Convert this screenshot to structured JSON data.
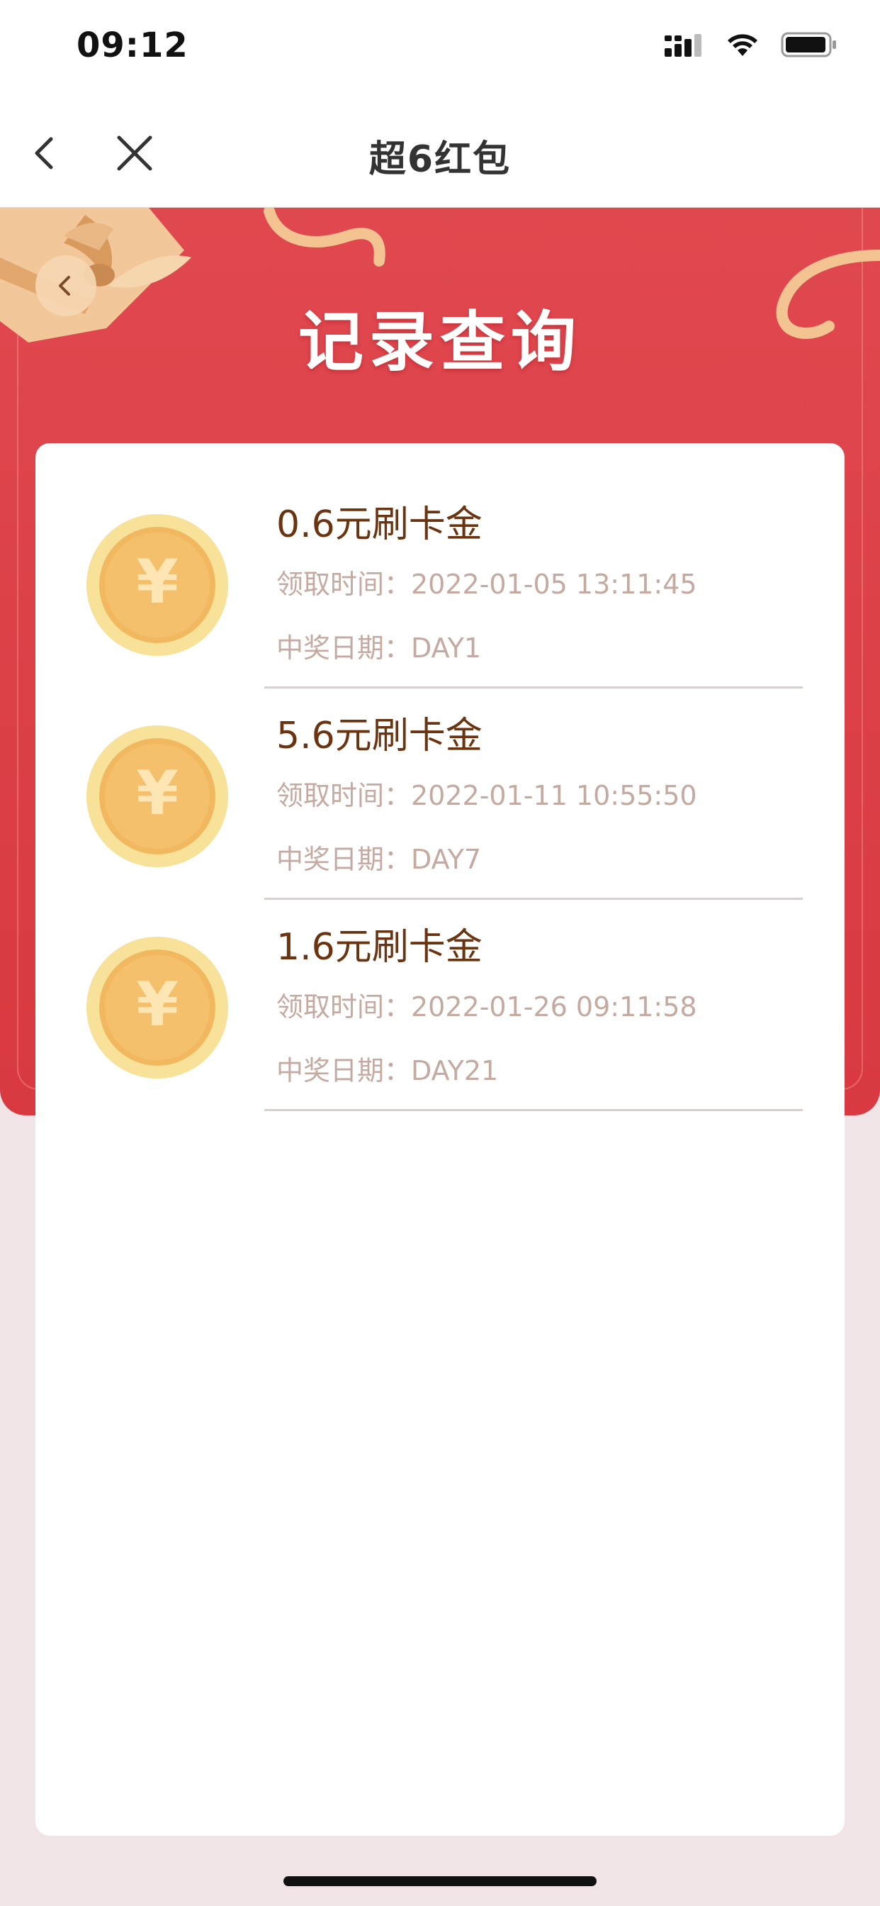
{
  "status_bar": {
    "time": "09:12"
  },
  "nav": {
    "title": "超6红包"
  },
  "banner": {
    "title": "记录查询"
  },
  "records": [
    {
      "title": "0.6元刷卡金",
      "time_label": "领取时间：2022-01-05 13:11:45",
      "date_label": "中奖日期：DAY1"
    },
    {
      "title": "5.6元刷卡金",
      "time_label": "领取时间：2022-01-11 10:55:50",
      "date_label": "中奖日期：DAY7"
    },
    {
      "title": "1.6元刷卡金",
      "time_label": "领取时间：2022-01-26 09:11:58",
      "date_label": "中奖日期：DAY21"
    }
  ],
  "colors": {
    "banner_red": "#dc4148",
    "title_brown": "#6b3410",
    "meta_gray": "#c4aaa0",
    "coin_gold": "#f3c56a"
  }
}
